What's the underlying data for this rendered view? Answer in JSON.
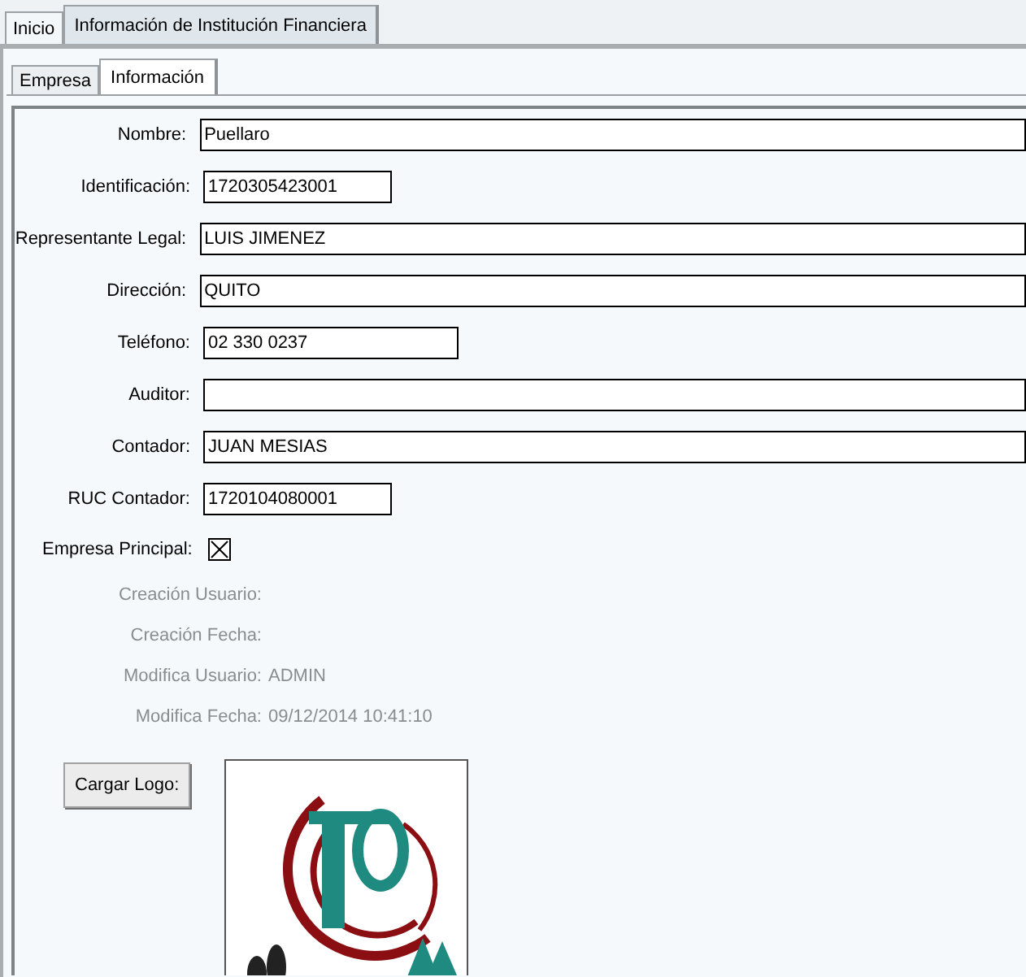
{
  "main_tabs": [
    {
      "label": "Inicio",
      "selected": false
    },
    {
      "label": "Información de Institución Financiera",
      "selected": true
    }
  ],
  "sub_tabs": [
    {
      "label": "Empresa",
      "selected": false
    },
    {
      "label": "Información",
      "selected": true
    }
  ],
  "fields": [
    {
      "label": "Nombre:",
      "value": "Puellaro"
    },
    {
      "label": "Identificación:",
      "value": "1720305423001"
    },
    {
      "label": "Representante Legal:",
      "value": "LUIS JIMENEZ"
    },
    {
      "label": "Dirección:",
      "value": "QUITO"
    },
    {
      "label": "Teléfono:",
      "value": "02 330 0237"
    },
    {
      "label": "Auditor:"
    },
    {
      "label": "Contador:",
      "value": "JUAN MESIAS"
    },
    {
      "label": "RUC Contador:",
      "value": "1720104080001"
    }
  ],
  "main_company": {
    "label": "Empresa Principal:",
    "checked": true
  },
  "audit": [
    {
      "label": "Creación Usuario:"
    },
    {
      "label": "Creación Fecha:"
    },
    {
      "label": "Modifica Usuario:",
      "value": "ADMIN"
    },
    {
      "label": "Modifica Fecha:",
      "value": "09/12/2014 10:41:10"
    }
  ],
  "upload_button": "Cargar Logo:"
}
